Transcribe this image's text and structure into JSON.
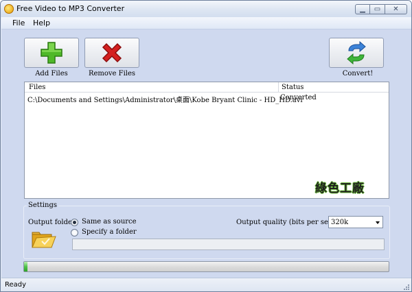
{
  "window": {
    "title": "Free Video to MP3 Converter"
  },
  "menu": {
    "items": [
      "File",
      "Help"
    ]
  },
  "toolbar": {
    "add_files": "Add Files",
    "remove_files": "Remove Files",
    "convert": "Convert!"
  },
  "files_list": {
    "columns": [
      "Files",
      "Status"
    ],
    "rows": [
      {
        "file": "C:\\Documents and Settings\\Administrator\\桌面\\Kobe Bryant Clinic - HD_HD.avi",
        "status": "Converted"
      }
    ],
    "watermark": "綠色工廠"
  },
  "settings": {
    "legend": "Settings",
    "output_folder_label": "Output folder:",
    "same_as_source": "Same as source",
    "specify_folder": "Specify a folder",
    "output_quality_label": "Output quality (bits per second):",
    "output_quality_value": "320k",
    "selected_option": "same_as_source"
  },
  "progress": {
    "fraction": 0.01
  },
  "statusbar": {
    "text": "Ready"
  },
  "colors": {
    "accent": "#cfd9ef",
    "progress": "#4fc34a"
  }
}
